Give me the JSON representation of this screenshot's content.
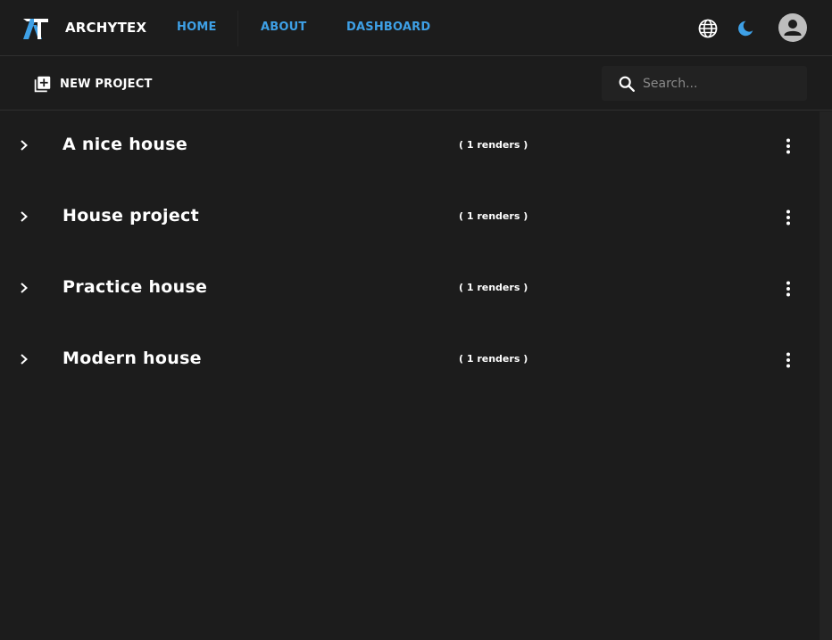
{
  "colors": {
    "background": "#1c1c1c",
    "accent": "#3ea0e6",
    "text": "#ffffff",
    "muted": "#8a8a8a"
  },
  "navbar": {
    "brand": "ARCHYTEX",
    "links": [
      "HOME",
      "ABOUT",
      "DASHBOARD"
    ],
    "icons": [
      "globe-icon",
      "moon-icon",
      "account-icon"
    ]
  },
  "toolbar": {
    "new_project_label": "NEW PROJECT",
    "search_placeholder": "Search..."
  },
  "projects": [
    {
      "name": "A nice house",
      "renders": "( 1 renders )"
    },
    {
      "name": "House project",
      "renders": "( 1 renders )"
    },
    {
      "name": "Practice house",
      "renders": "( 1 renders )"
    },
    {
      "name": "Modern house",
      "renders": "( 1 renders )"
    }
  ]
}
